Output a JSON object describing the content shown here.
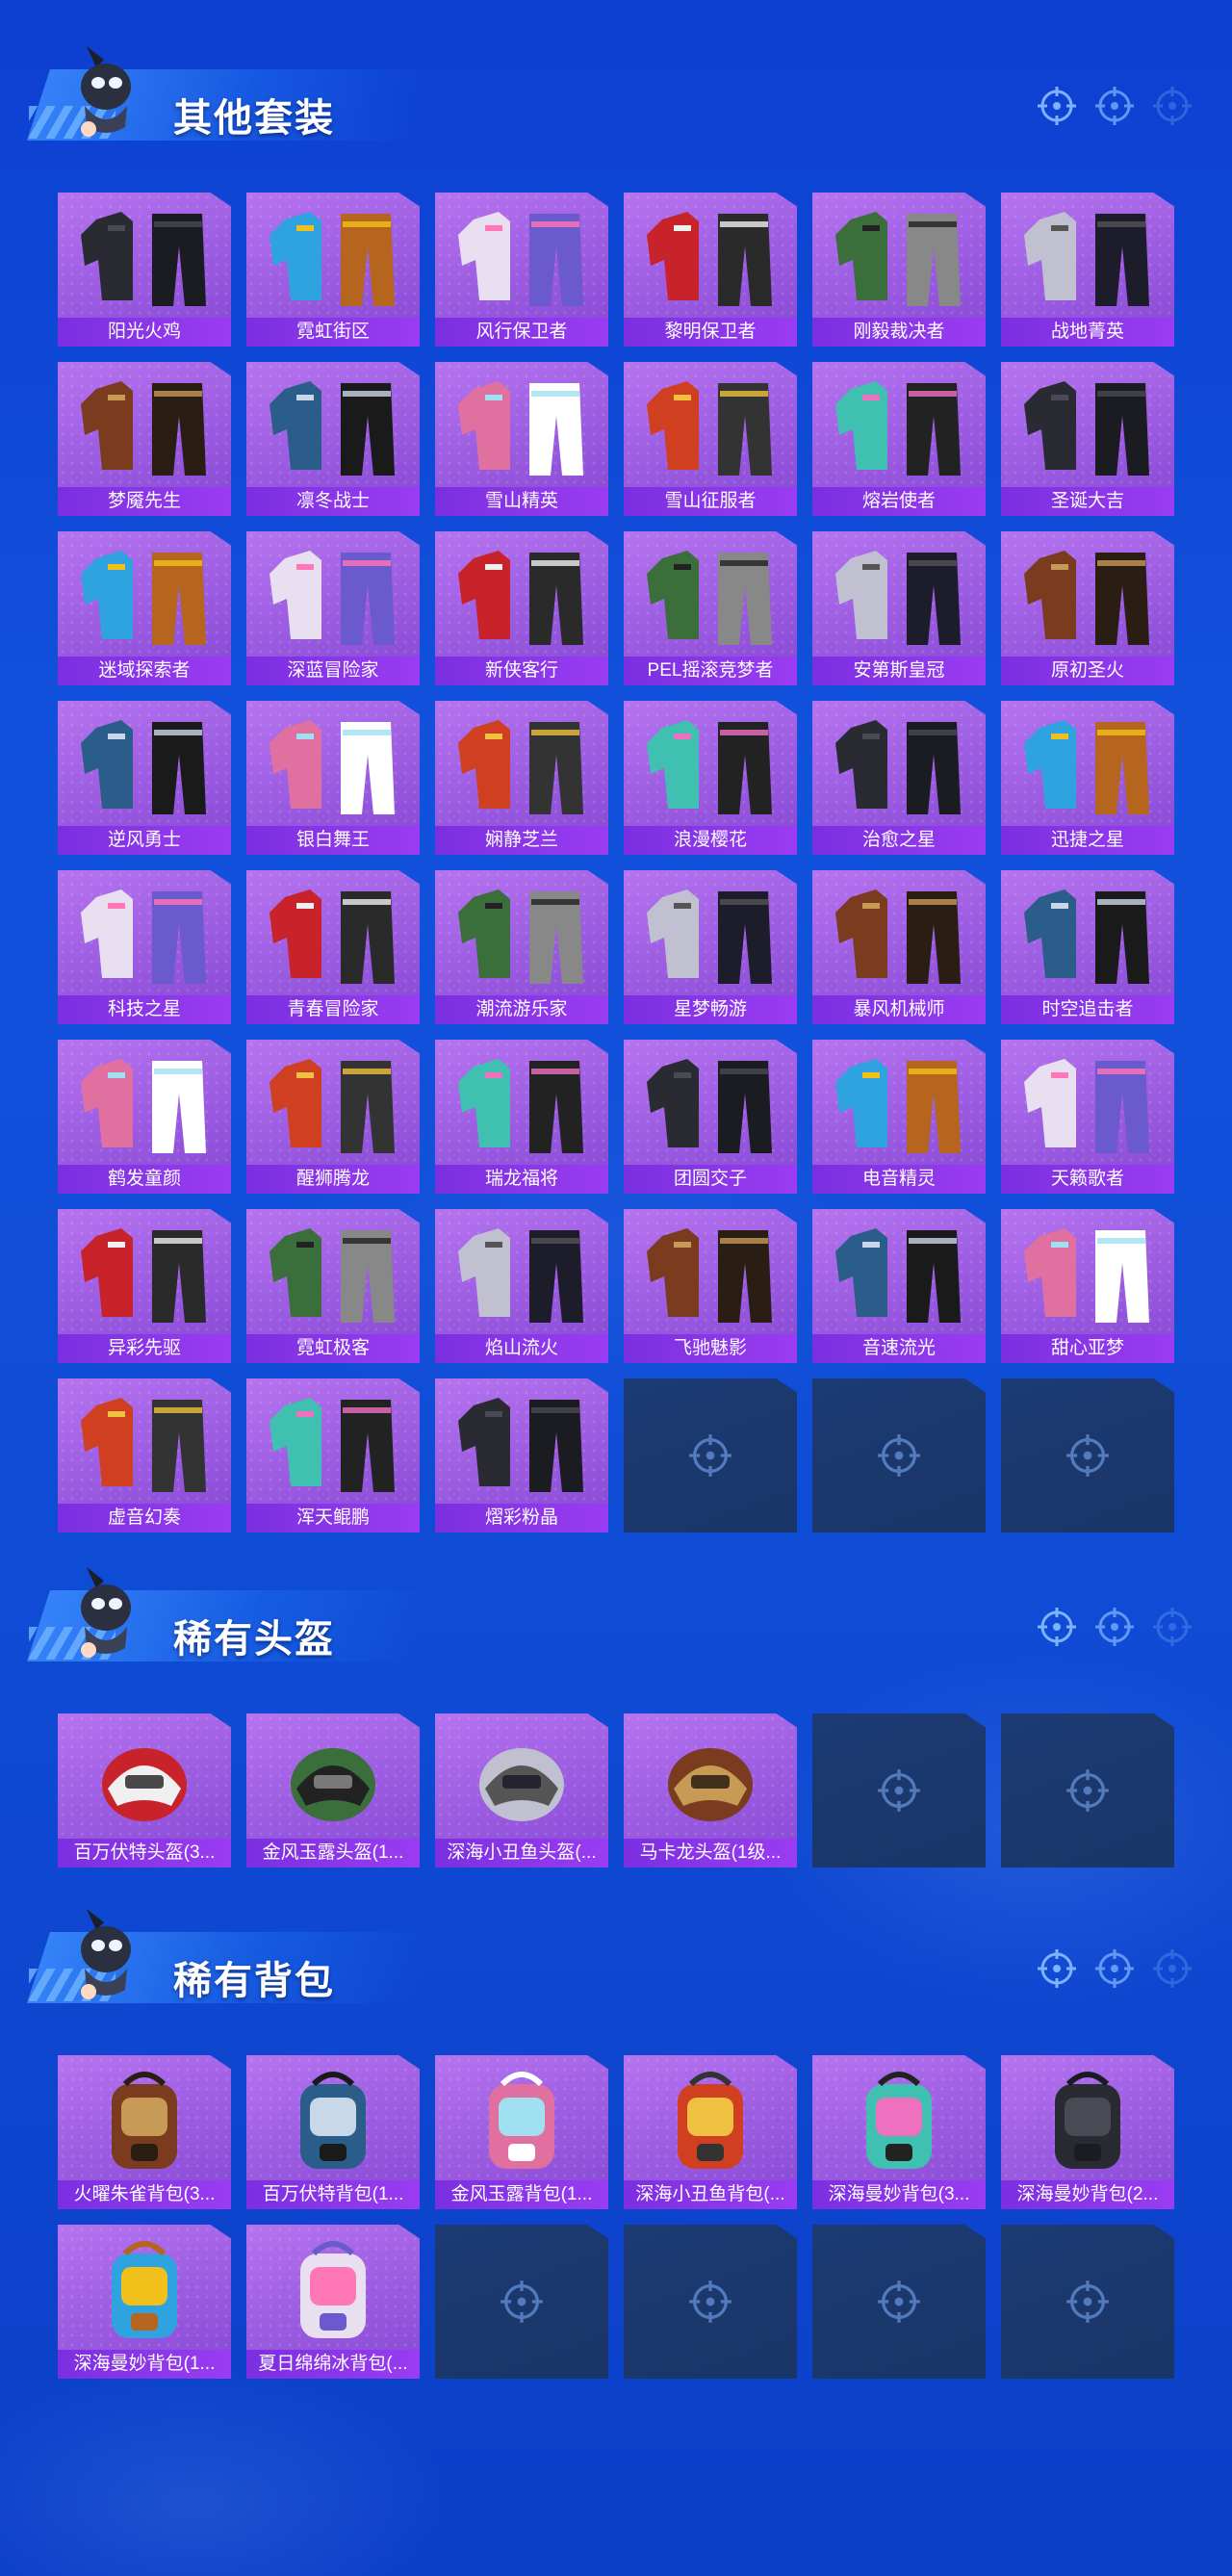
{
  "sections": [
    {
      "title": "其他套装",
      "items": [
        "阳光火鸡",
        "霓虹街区",
        "风行保卫者",
        "黎明保卫者",
        "刚毅裁决者",
        "战地菁英",
        "梦魇先生",
        "凛冬战士",
        "雪山精英",
        "雪山征服者",
        "熔岩使者",
        "圣诞大吉",
        "迷域探索者",
        "深蓝冒险家",
        "新侠客行",
        "PEL摇滚竞梦者",
        "安第斯皇冠",
        "原初圣火",
        "逆风勇士",
        "银白舞王",
        "娴静芝兰",
        "浪漫樱花",
        "治愈之星",
        "迅捷之星",
        "科技之星",
        "青春冒险家",
        "潮流游乐家",
        "星梦畅游",
        "暴风机械师",
        "时空追击者",
        "鹤发童颜",
        "醒狮腾龙",
        "瑞龙福将",
        "团圆交子",
        "电音精灵",
        "天籁歌者",
        "异彩先驱",
        "霓虹极客",
        "焰山流火",
        "飞驰魅影",
        "音速流光",
        "甜心亚梦",
        "虚音幻奏",
        "浑天鲲鹏",
        "熠彩粉晶"
      ],
      "empty_slots": 3
    },
    {
      "title": "稀有头盔",
      "items": [
        "百万伏特头盔(3...",
        "金风玉露头盔(1...",
        "深海小丑鱼头盔(...",
        "马卡龙头盔(1级..."
      ],
      "empty_slots": 2
    },
    {
      "title": "稀有背包",
      "items": [
        "火曜朱雀背包(3...",
        "百万伏特背包(1...",
        "金风玉露背包(1...",
        "深海小丑鱼背包(...",
        "深海曼妙背包(3...",
        "深海曼妙背包(2...",
        "深海曼妙背包(1...",
        "夏日绵绵冰背包(..."
      ],
      "empty_slots": 4
    }
  ],
  "icons": {
    "mascot": "mascot-icon",
    "header_marks": "crosshair-icon",
    "empty_slot": "crosshair-icon"
  },
  "colors": {
    "background": "#1152dc",
    "card": "#a565e8",
    "card_label": "#8a36ea",
    "empty_card": "#1c3b74"
  }
}
